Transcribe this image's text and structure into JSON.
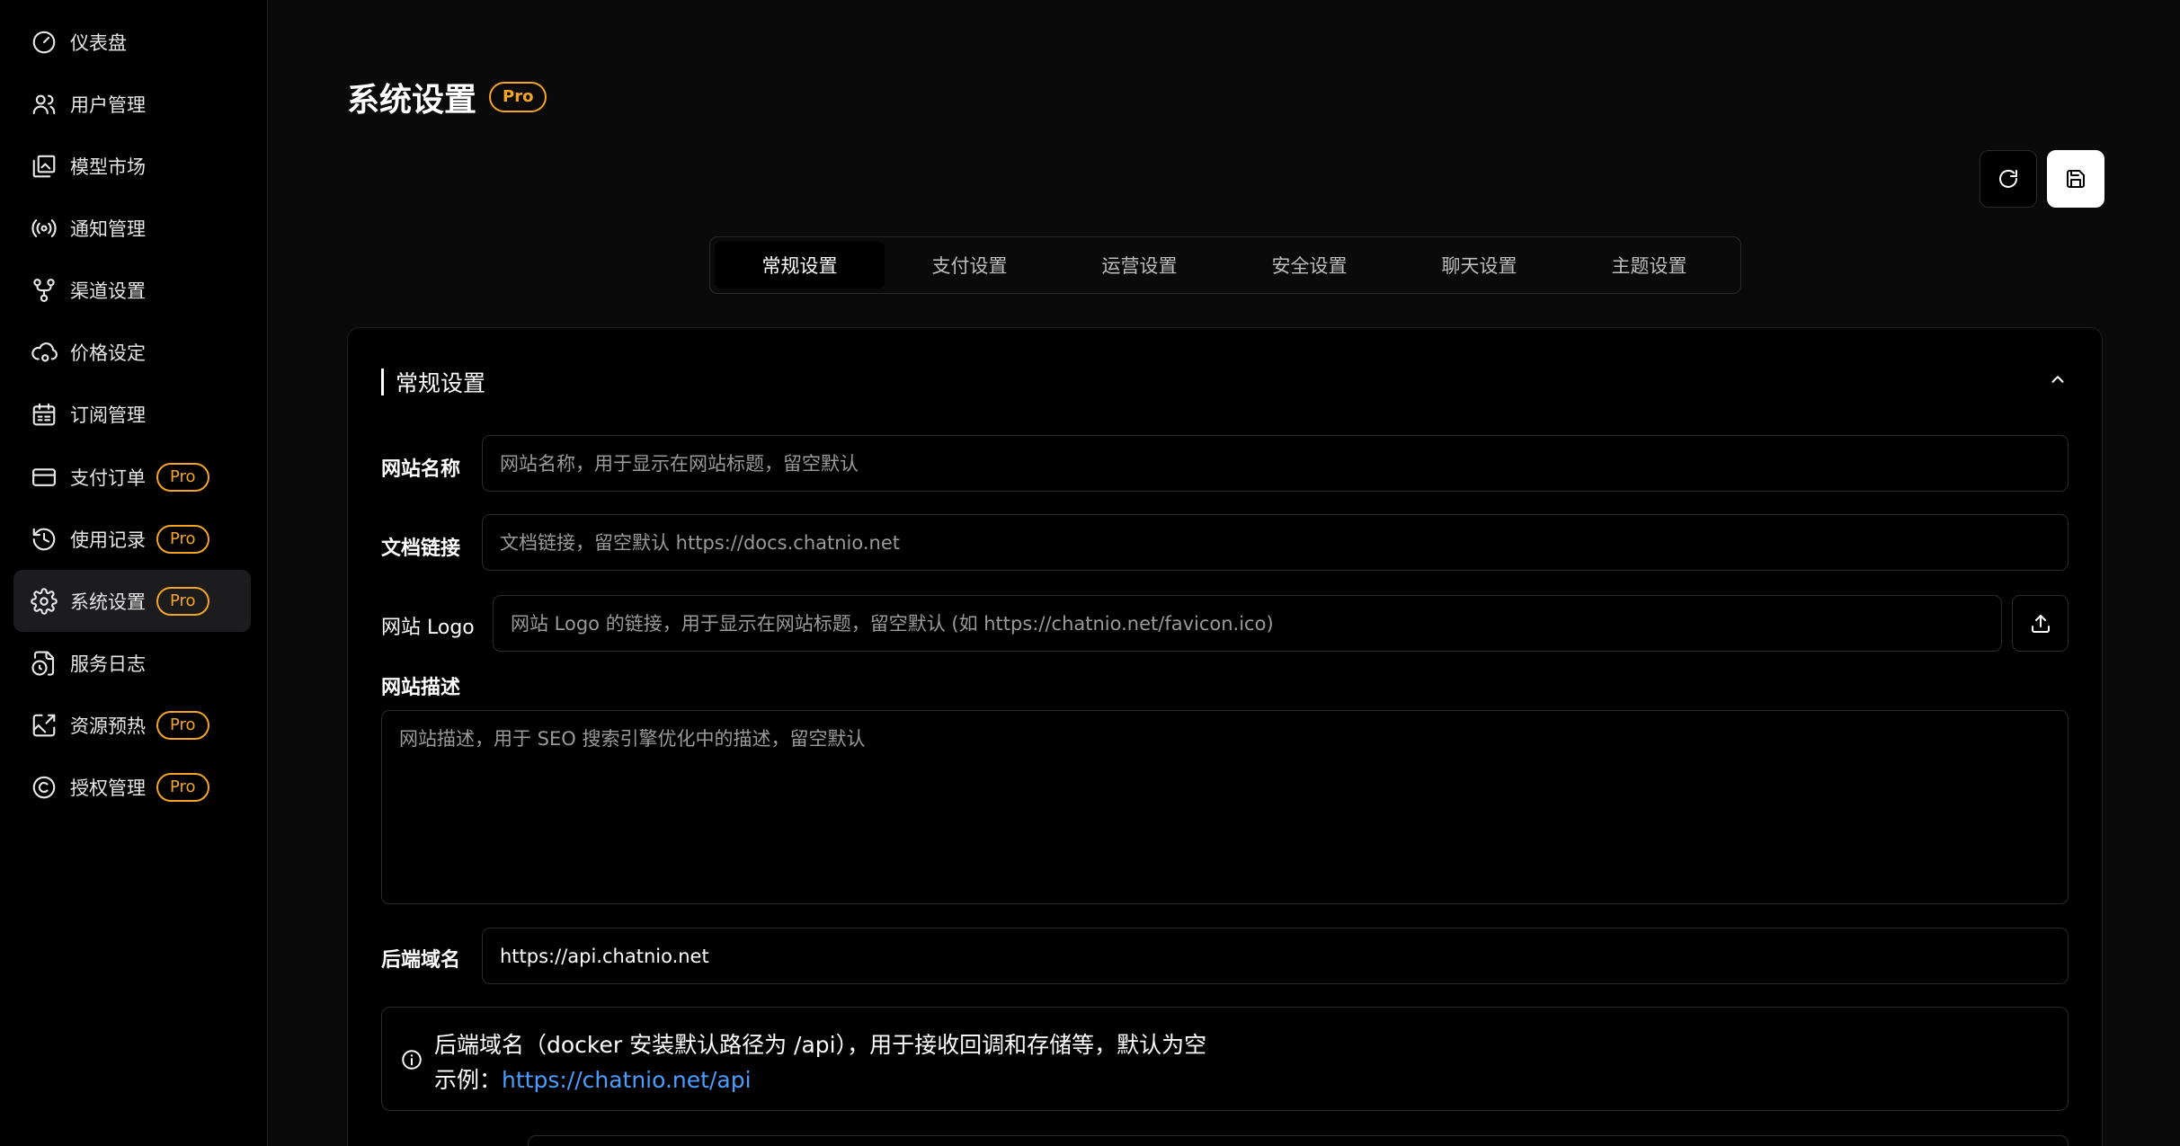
{
  "sidebar": {
    "items": [
      {
        "label": "仪表盘",
        "icon": "gauge-icon",
        "pro": ""
      },
      {
        "label": "用户管理",
        "icon": "users-icon",
        "pro": ""
      },
      {
        "label": "模型市场",
        "icon": "gallery-icon",
        "pro": ""
      },
      {
        "label": "通知管理",
        "icon": "radio-icon",
        "pro": ""
      },
      {
        "label": "渠道设置",
        "icon": "git-fork-icon",
        "pro": ""
      },
      {
        "label": "价格设定",
        "icon": "cloud-cog-icon",
        "pro": ""
      },
      {
        "label": "订阅管理",
        "icon": "calendar-icon",
        "pro": ""
      },
      {
        "label": "支付订单",
        "icon": "credit-card-icon",
        "pro": "Pro"
      },
      {
        "label": "使用记录",
        "icon": "history-icon",
        "pro": "Pro"
      },
      {
        "label": "系统设置",
        "icon": "settings-icon",
        "pro": "Pro",
        "active": true
      },
      {
        "label": "服务日志",
        "icon": "file-clock-icon",
        "pro": ""
      },
      {
        "label": "资源预热",
        "icon": "image-upscale-icon",
        "pro": "Pro"
      },
      {
        "label": "授权管理",
        "icon": "copyright-icon",
        "pro": "Pro"
      }
    ]
  },
  "header": {
    "title": "系统设置",
    "title_badge": "Pro"
  },
  "tabs": [
    {
      "label": "常规设置",
      "active": true
    },
    {
      "label": "支付设置"
    },
    {
      "label": "运营设置"
    },
    {
      "label": "安全设置"
    },
    {
      "label": "聊天设置"
    },
    {
      "label": "主题设置"
    }
  ],
  "general": {
    "section_title": "常规设置",
    "site_name": {
      "label": "网站名称",
      "value": "",
      "placeholder": "网站名称，用于显示在网站标题，留空默认"
    },
    "docs_link": {
      "label": "文档链接",
      "value": "",
      "placeholder": "文档链接，留空默认 https://docs.chatnio.net"
    },
    "site_logo": {
      "label": "网站 Logo",
      "value": "",
      "placeholder": "网站 Logo 的链接，用于显示在网站标题，留空默认 (如 https://chatnio.net/favicon.ico)"
    },
    "site_desc": {
      "label": "网站描述",
      "value": "",
      "placeholder": "网站描述，用于 SEO 搜索引擎优化中的描述，留空默认"
    },
    "backend": {
      "label": "后端域名",
      "value": "https://api.chatnio.net",
      "placeholder": ""
    },
    "notice": {
      "line1": "后端域名（docker 安装默认路径为 /api），用于接收回调和存储等，默认为空",
      "example_prefix": "示例：",
      "example_link": "https://chatnio.net/api"
    }
  },
  "colors": {
    "accent_pro": "#f5a524",
    "link": "#4a9eff",
    "background": "#000000"
  }
}
